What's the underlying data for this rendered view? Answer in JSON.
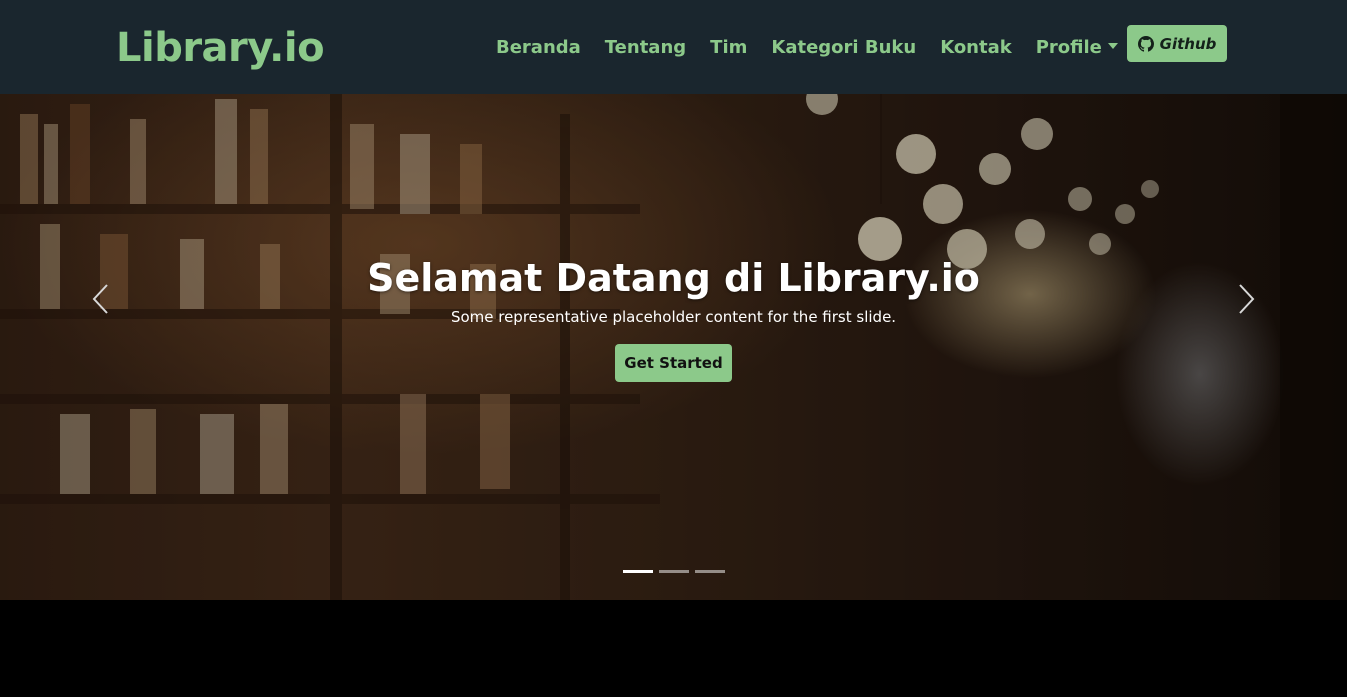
{
  "navbar": {
    "brand": "Library.io",
    "links": [
      "Beranda",
      "Tentang",
      "Tim",
      "Kategori Buku",
      "Kontak"
    ],
    "profile_label": "Profile",
    "github_label": "Github",
    "github_icon": "github-icon",
    "colors": {
      "background": "#1a262e",
      "accent": "#8cc98a"
    }
  },
  "hero": {
    "title": "Selamat Datang di Library.io",
    "subtitle": "Some representative placeholder content for the first slide.",
    "cta_label": "Get Started",
    "slides_count": 3,
    "active_slide": 1,
    "prev_icon": "chevron-left-icon",
    "next_icon": "chevron-right-icon"
  }
}
